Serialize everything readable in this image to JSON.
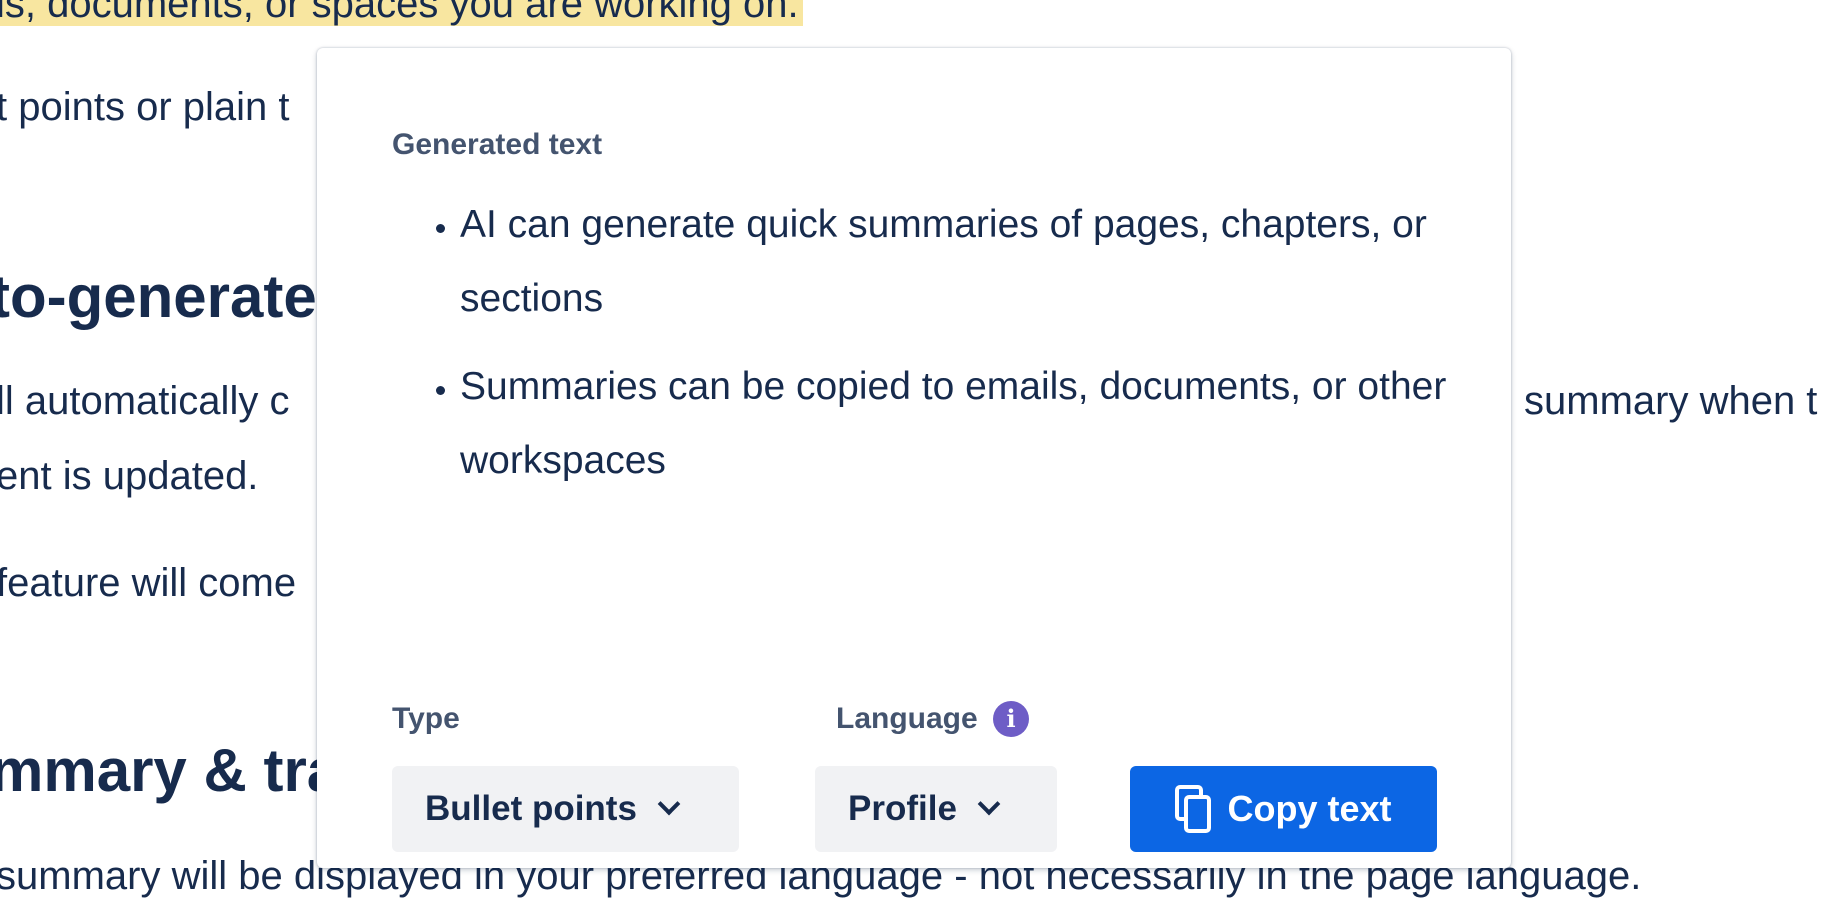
{
  "background": {
    "highlighted_line": "ls, documents, or spaces you are working on.",
    "line_bullet_plain": "t points or plain t",
    "heading_auto": "to-generate",
    "line_auto_1": "ll automatically c",
    "line_auto_1_right": "summary when t",
    "line_auto_2": "ent is updated.",
    "line_feature": "feature will come",
    "heading_summary": "mmary & tra",
    "line_bottom": "summary will be displayed in your preferred language - not necessarily in the page language."
  },
  "panel": {
    "generated_label": "Generated text",
    "bullets": [
      "AI can generate quick summaries of pages, chapters, or sections",
      "Summaries can be copied to emails, documents, or other workspaces"
    ],
    "type_label": "Type",
    "type_value": "Bullet points",
    "language_label": "Language",
    "info_icon_glyph": "i",
    "language_value": "Profile",
    "copy_button": "Copy text",
    "colors": {
      "primary": "#0c66e4",
      "info": "#6e5dc6",
      "select_bg": "#f1f2f4",
      "highlight": "#f8e6a0"
    },
    "icons": {
      "info": "info-icon",
      "chevron": "chevron-down-icon",
      "copy": "copy-icon"
    }
  }
}
